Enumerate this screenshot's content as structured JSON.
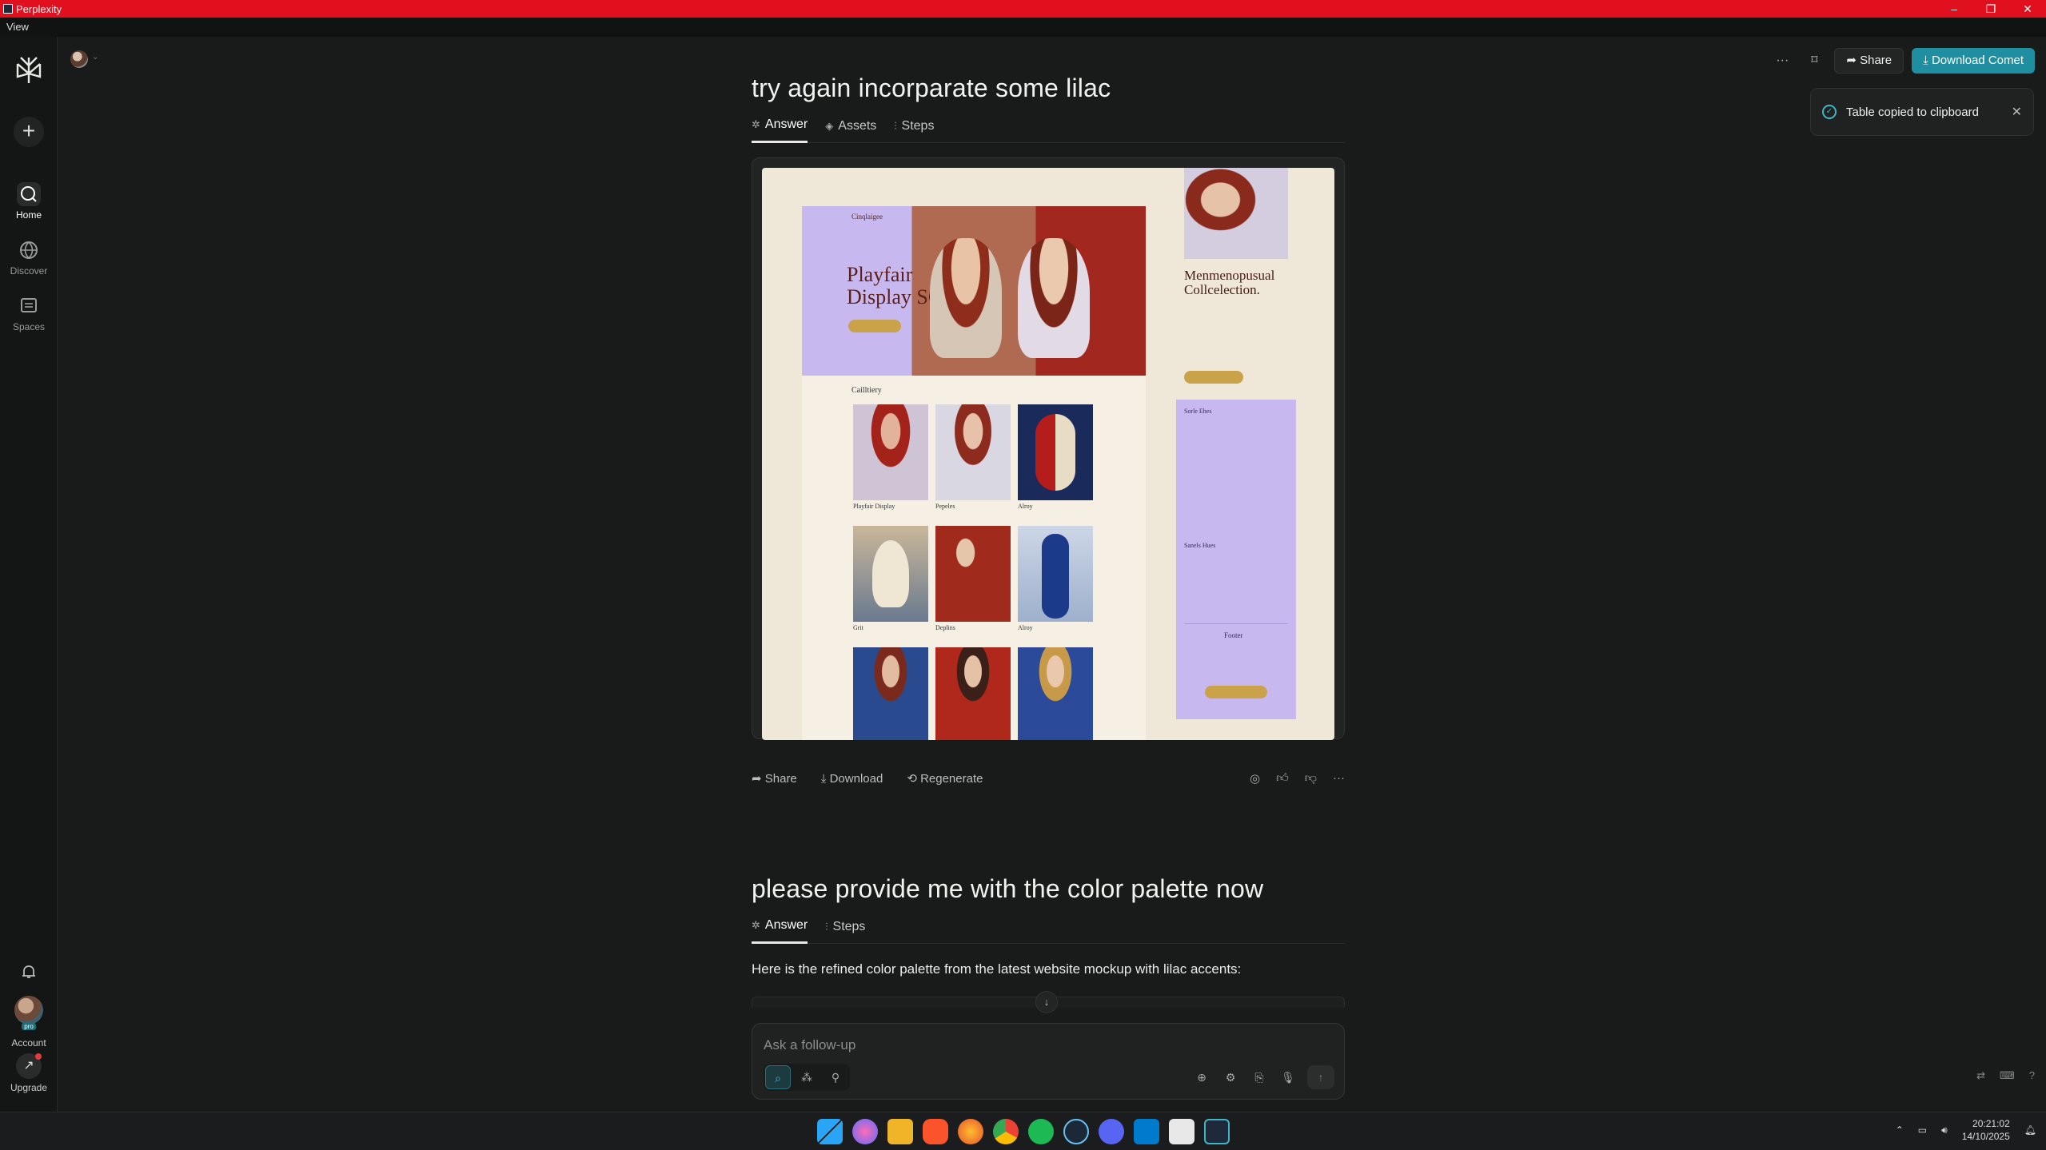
{
  "window": {
    "title": "Perplexity",
    "menu": "View",
    "minimize": "–",
    "maximize": "❐",
    "close": "✕"
  },
  "sidebar": {
    "new_icon": "+",
    "items": [
      {
        "label": "Home",
        "icon": "home-icon"
      },
      {
        "label": "Discover",
        "icon": "globe-icon"
      },
      {
        "label": "Spaces",
        "icon": "spaces-icon"
      }
    ],
    "account_label": "Account",
    "account_badge": "pro",
    "upgrade_label": "Upgrade"
  },
  "header": {
    "more": "···",
    "bookmark": "⌑",
    "share_label": "Share",
    "download_label": "Download Comet"
  },
  "toast": {
    "message": "Table copied to clipboard",
    "check": "✓",
    "close": "✕"
  },
  "thread": [
    {
      "question": "try again incorparate some lilac",
      "tabs": [
        {
          "label": "Answer",
          "icon": "✲"
        },
        {
          "label": "Assets",
          "icon": "◈"
        },
        {
          "label": "Steps",
          "icon": "⫶"
        }
      ],
      "image": {
        "nav_logo": "Cinqlaigee",
        "hero_title": "Playfair Display SC",
        "side_title": "Menmenopusual Collcelection.",
        "gallery_label": "Cailltiery",
        "captions": [
          "Playfair Display",
          "Pepeles",
          "Alroy",
          "Grit",
          "Deplins",
          "Alroy"
        ],
        "footer_label": "Footer",
        "panel_heading_1": "Sorle Ehes",
        "panel_heading_2": "Sanels Hues"
      },
      "actions": {
        "share": "Share",
        "download": "Download",
        "regenerate": "Regenerate"
      }
    },
    {
      "question": "please provide me with the color palette now",
      "tabs": [
        {
          "label": "Answer",
          "icon": "✲"
        },
        {
          "label": "Steps",
          "icon": "⫶"
        }
      ],
      "answer": "Here is the refined color palette from the latest website mockup with lilac accents:"
    }
  ],
  "composer": {
    "placeholder": "Ask a follow-up",
    "scroll_down": "↓"
  },
  "taskbar": {
    "time": "20:21:02",
    "date": "14/10/2025"
  },
  "colors": {
    "accent": "#1f8ea0",
    "titlebar": "#e0101f",
    "lilac": "#c8b8f0",
    "cream": "#efe7d7"
  }
}
